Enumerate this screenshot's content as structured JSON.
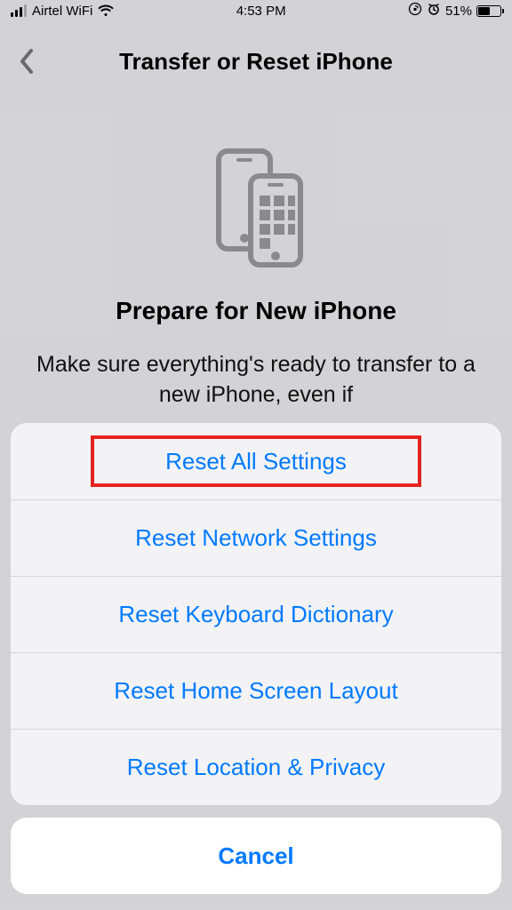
{
  "status_bar": {
    "carrier": "Airtel WiFi",
    "time": "4:53 PM",
    "battery_pct": "51%"
  },
  "nav": {
    "title": "Transfer or Reset iPhone"
  },
  "content": {
    "prepare_title": "Prepare for New iPhone",
    "prepare_desc": "Make sure everything's ready to transfer to a new iPhone, even if"
  },
  "sheet": {
    "items": [
      "Reset All Settings",
      "Reset Network Settings",
      "Reset Keyboard Dictionary",
      "Reset Home Screen Layout",
      "Reset Location & Privacy"
    ],
    "cancel": "Cancel"
  }
}
